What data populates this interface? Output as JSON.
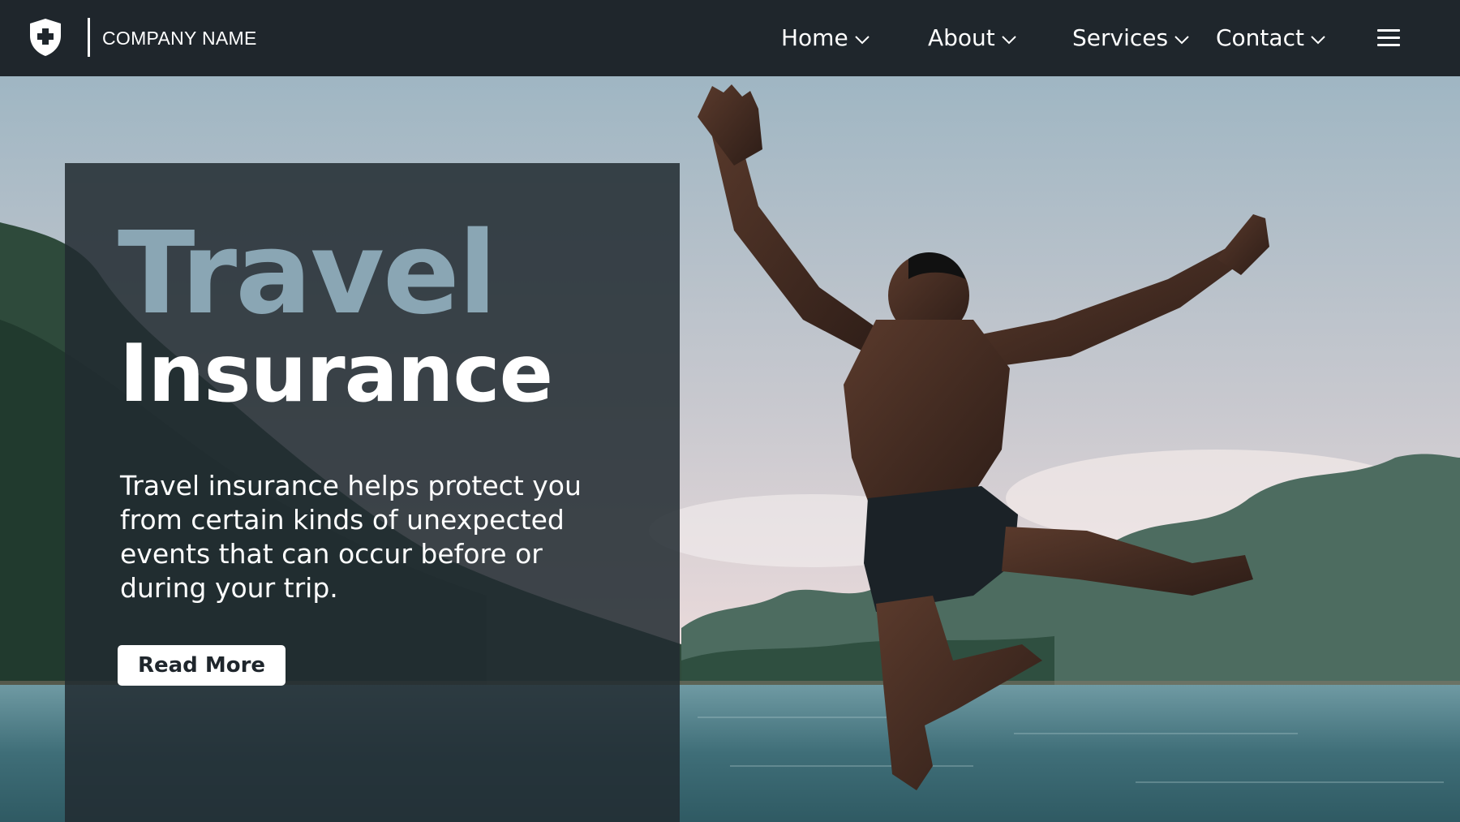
{
  "header": {
    "brand": "COMPANY NAME",
    "logo_icon": "shield-plus-icon",
    "nav": [
      {
        "label": "Home",
        "icon": "chevron-down-icon"
      },
      {
        "label": "About",
        "icon": "chevron-down-icon"
      },
      {
        "label": "Services",
        "icon": "chevron-down-icon"
      },
      {
        "label": "Contact",
        "icon": "chevron-down-icon"
      }
    ],
    "menu_icon": "hamburger-menu-icon"
  },
  "hero": {
    "title_line1": "Travel",
    "title_line2": "Insurance",
    "description": "Travel insurance helps protect you from certain kinds of unexpected events that can occur before or during your trip.",
    "cta_label": "Read More"
  },
  "colors": {
    "nav_bg": "#1f262c",
    "panel_bg": "#222b31",
    "accent_title": "#8aa6b4",
    "button_bg": "#ffffff"
  }
}
